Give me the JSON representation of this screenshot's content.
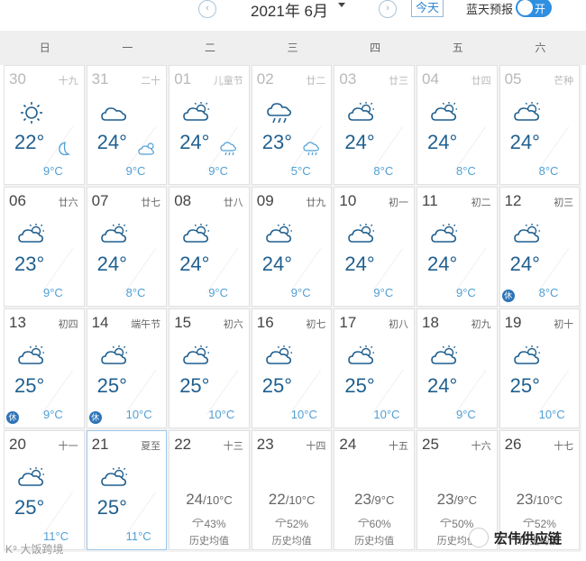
{
  "header": {
    "prev_icon": "chevron-left-icon",
    "next_icon": "chevron-right-icon",
    "prev_glyph": "‹",
    "next_glyph": "›",
    "month_title": "2021年 6月",
    "today_label": "今天",
    "forecast_label": "蓝天预报",
    "toggle_label": "开",
    "toggle_on": true
  },
  "weekdays": [
    "日",
    "一",
    "二",
    "三",
    "四",
    "五",
    "六"
  ],
  "colors": {
    "accent": "#2f8fe0",
    "temp_high": "#1f5f8f",
    "temp_low": "#4f9fd4",
    "holiday_badge": "#2d74b8"
  },
  "weeks": [
    [
      {
        "day": "30",
        "lunar": "十九",
        "type": "sun-moon",
        "high": "22°",
        "low": "9°C",
        "faded": true
      },
      {
        "day": "31",
        "lunar": "二十",
        "type": "cloud-partly",
        "high": "24°",
        "low": "9°C",
        "faded": true
      },
      {
        "day": "01",
        "lunar": "儿童节",
        "type": "partly-rain",
        "high": "24°",
        "low": "9°C",
        "faded": true
      },
      {
        "day": "02",
        "lunar": "廿二",
        "type": "rain-rain",
        "high": "23°",
        "low": "5°C",
        "faded": true
      },
      {
        "day": "03",
        "lunar": "廿三",
        "type": "partly",
        "high": "24°",
        "low": "8°C",
        "faded": true
      },
      {
        "day": "04",
        "lunar": "廿四",
        "type": "partly",
        "high": "24°",
        "low": "8°C",
        "faded": true
      },
      {
        "day": "05",
        "lunar": "芒种",
        "type": "partly",
        "high": "24°",
        "low": "8°C",
        "faded": true
      }
    ],
    [
      {
        "day": "06",
        "lunar": "廿六",
        "type": "partly",
        "high": "23°",
        "low": "9°C"
      },
      {
        "day": "07",
        "lunar": "廿七",
        "type": "partly",
        "high": "24°",
        "low": "8°C"
      },
      {
        "day": "08",
        "lunar": "廿八",
        "type": "partly",
        "high": "24°",
        "low": "9°C"
      },
      {
        "day": "09",
        "lunar": "廿九",
        "type": "partly",
        "high": "24°",
        "low": "9°C"
      },
      {
        "day": "10",
        "lunar": "初一",
        "type": "partly",
        "high": "24°",
        "low": "9°C"
      },
      {
        "day": "11",
        "lunar": "初二",
        "type": "partly",
        "high": "24°",
        "low": "9°C"
      },
      {
        "day": "12",
        "lunar": "初三",
        "type": "partly",
        "high": "24°",
        "low": "8°C",
        "holiday": "休"
      }
    ],
    [
      {
        "day": "13",
        "lunar": "初四",
        "type": "partly",
        "high": "25°",
        "low": "9°C",
        "holiday": "休"
      },
      {
        "day": "14",
        "lunar": "端午节",
        "type": "partly",
        "high": "25°",
        "low": "10°C",
        "holiday": "休"
      },
      {
        "day": "15",
        "lunar": "初六",
        "type": "partly",
        "high": "25°",
        "low": "10°C"
      },
      {
        "day": "16",
        "lunar": "初七",
        "type": "partly",
        "high": "25°",
        "low": "10°C"
      },
      {
        "day": "17",
        "lunar": "初八",
        "type": "partly",
        "high": "25°",
        "low": "10°C"
      },
      {
        "day": "18",
        "lunar": "初九",
        "type": "partly",
        "high": "24°",
        "low": "9°C"
      },
      {
        "day": "19",
        "lunar": "初十",
        "type": "partly",
        "high": "25°",
        "low": "10°C"
      }
    ],
    [
      {
        "day": "20",
        "lunar": "十一",
        "type": "partly",
        "high": "25°",
        "low": "11°C"
      },
      {
        "day": "21",
        "lunar": "夏至",
        "type": "partly",
        "high": "25°",
        "low": "11°C",
        "selected": true
      },
      {
        "day": "22",
        "lunar": "十三",
        "type": "history",
        "hist_high": "24",
        "hist_low": "/10°C",
        "rain": "43%",
        "hist_label": "历史均值"
      },
      {
        "day": "23",
        "lunar": "十四",
        "type": "history",
        "hist_high": "22",
        "hist_low": "/10°C",
        "rain": "52%",
        "hist_label": "历史均值"
      },
      {
        "day": "24",
        "lunar": "十五",
        "type": "history",
        "hist_high": "23",
        "hist_low": "/9°C",
        "rain": "60%",
        "hist_label": "历史均值"
      },
      {
        "day": "25",
        "lunar": "十六",
        "type": "history",
        "hist_high": "23",
        "hist_low": "/9°C",
        "rain": "50%",
        "hist_label": "历史均值"
      },
      {
        "day": "26",
        "lunar": "十七",
        "type": "history",
        "hist_high": "23",
        "hist_low": "/10°C",
        "rain": "52%",
        "hist_label": "历史均值"
      }
    ]
  ],
  "watermarks": {
    "left": "K⁹ 大饭跨境",
    "right": "宏伟供应链"
  }
}
